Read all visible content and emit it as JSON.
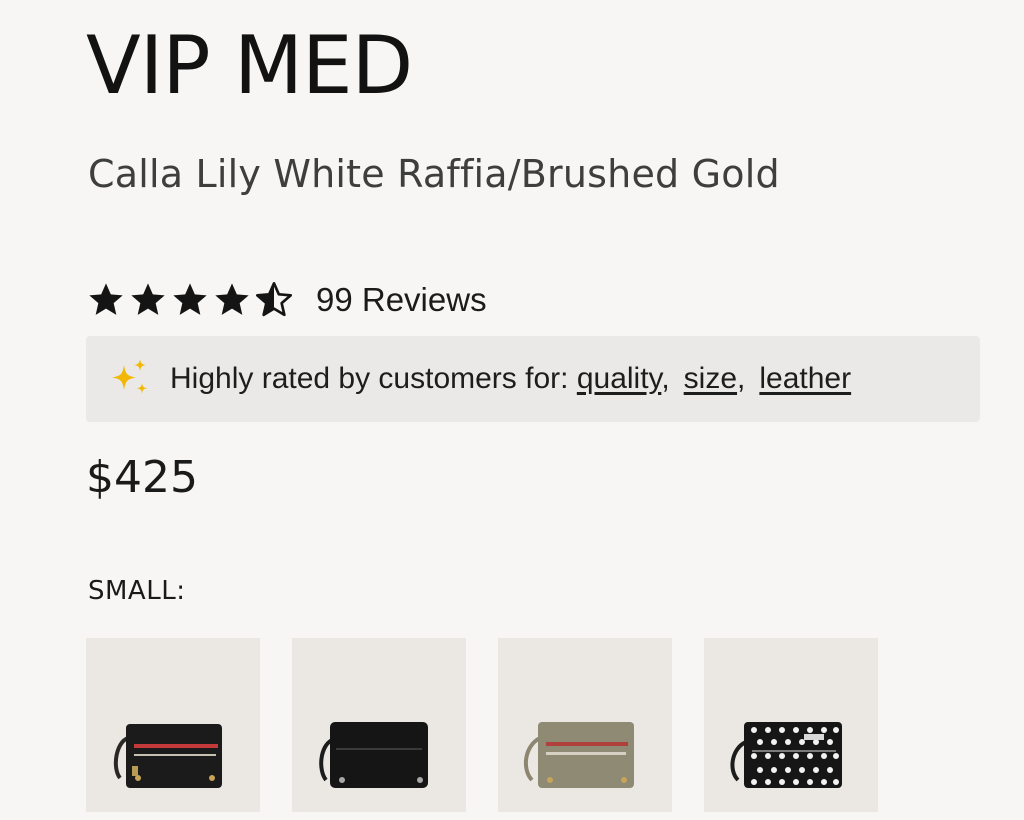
{
  "product": {
    "title": "VIP MED",
    "variant": "Calla Lily White Raffia/Brushed Gold",
    "price": "$425"
  },
  "rating": {
    "value": 4.5,
    "max": 5,
    "reviews_label": "99 Reviews"
  },
  "insights": {
    "prefix": "Highly rated by customers for:",
    "tags": [
      "quality",
      "size",
      "leather"
    ],
    "icon": "sparkle-icon",
    "icon_color": "#f2b705"
  },
  "sizes": {
    "label": "SMALL:",
    "swatches": [
      {
        "name": "black-red-zip",
        "icon": "handbag-icon"
      },
      {
        "name": "black-solid",
        "icon": "handbag-icon"
      },
      {
        "name": "taupe-red-zip",
        "icon": "handbag-icon"
      },
      {
        "name": "black-polka-dot",
        "icon": "handbag-icon"
      }
    ]
  },
  "colors": {
    "background": "#f7f6f4",
    "banner": "#eae9e7",
    "text": "#141414"
  }
}
